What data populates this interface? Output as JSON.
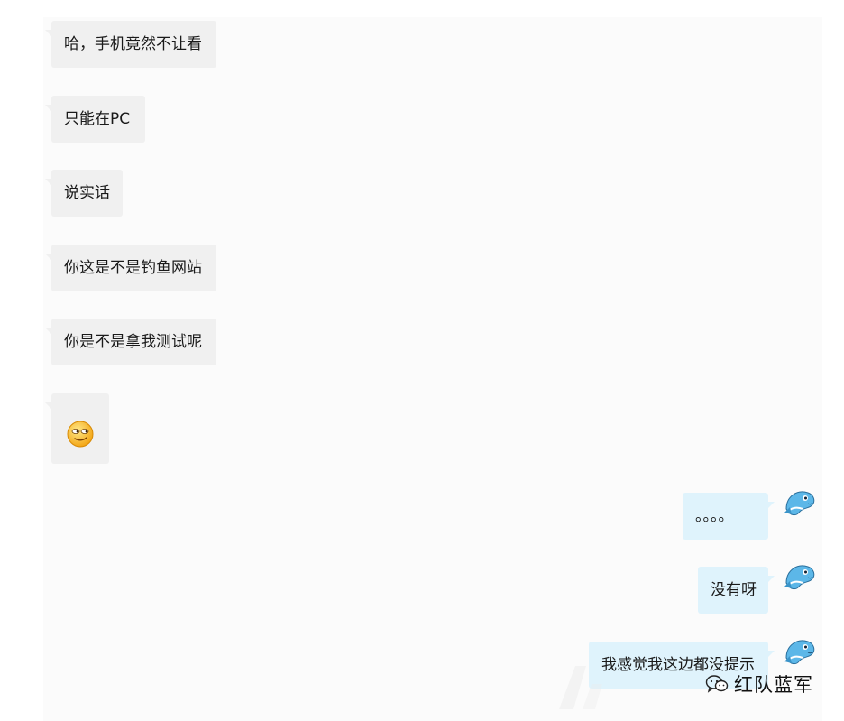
{
  "conversation": {
    "incoming": [
      {
        "text": "哈，手机竟然不让看"
      },
      {
        "text": "只能在PC"
      },
      {
        "text": "说实话"
      },
      {
        "text": "你这是不是钓鱼网站"
      },
      {
        "text": "你是不是拿我测试呢"
      },
      {
        "emoji": "smirk-face-emoji"
      }
    ],
    "outgoing": [
      {
        "text": "。。。。"
      },
      {
        "text": "没有呀"
      },
      {
        "text": "我感觉我这边都没提示"
      }
    ]
  },
  "watermark": {
    "brand": "红队蓝军",
    "icon": "wechat-icon"
  },
  "colors": {
    "incoming_bubble": "#f0f0f0",
    "outgoing_bubble": "#dff3fc",
    "panel": "#fbfbfb"
  }
}
